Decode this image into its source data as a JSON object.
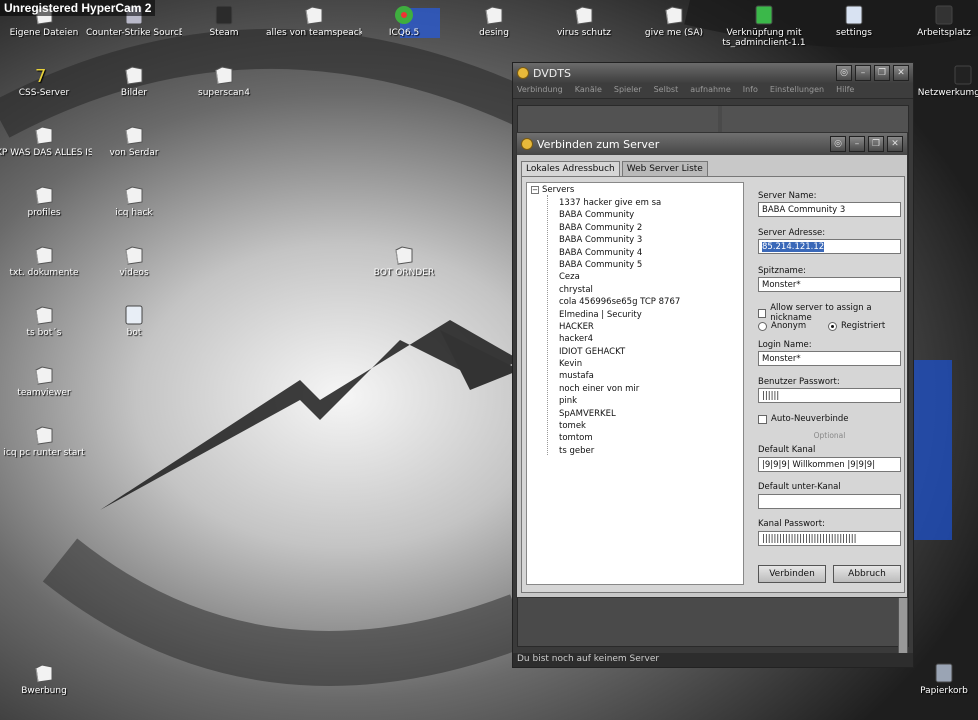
{
  "watermark": "Unregistered HyperCam 2",
  "desktop_icons": [
    {
      "label": "Eigene Dateien",
      "icon": "folder-icon"
    },
    {
      "label": "Counter-Strike SourcE",
      "icon": "cs-icon"
    },
    {
      "label": "Steam",
      "icon": "steam-icon"
    },
    {
      "label": "alles von teamspeack",
      "icon": "folder-icon"
    },
    {
      "label": "ICQ6.5",
      "icon": "icq-icon"
    },
    {
      "label": "desing",
      "icon": "folder-icon"
    },
    {
      "label": "virus schutz",
      "icon": "folder-icon"
    },
    {
      "label": "give me (SA)",
      "icon": "folder-icon"
    },
    {
      "label": "Verknüpfung mit ts_adminclient-1.1",
      "icon": "shortcut-icon"
    },
    {
      "label": "settings",
      "icon": "settings-icon"
    },
    {
      "label": "Arbeitsplatz",
      "icon": "computer-icon"
    },
    {
      "label": "CSS-Server",
      "icon": "server-icon"
    },
    {
      "label": "Bilder",
      "icon": "folder-icon"
    },
    {
      "label": "superscan4",
      "icon": "folder-icon"
    },
    {
      "label": "Netzwerkumgebung",
      "icon": "network-icon"
    },
    {
      "label": "KP WAS DAS ALLES IST",
      "icon": "folder-icon"
    },
    {
      "label": "von Serdar",
      "icon": "folder-icon"
    },
    {
      "label": "profiles",
      "icon": "folder-icon"
    },
    {
      "label": "icq hack",
      "icon": "folder-icon"
    },
    {
      "label": "txt. dokumente",
      "icon": "folder-icon"
    },
    {
      "label": "videos",
      "icon": "folder-icon"
    },
    {
      "label": "BOT ORNDER",
      "icon": "folder-icon"
    },
    {
      "label": "ts bot´s",
      "icon": "folder-icon"
    },
    {
      "label": "bot",
      "icon": "file-icon"
    },
    {
      "label": "teamviewer",
      "icon": "folder-icon"
    },
    {
      "label": "icq pc runter start",
      "icon": "folder-icon"
    },
    {
      "label": "Bwerbung",
      "icon": "folder-icon"
    },
    {
      "label": "Papierkorb",
      "icon": "recycle-bin-icon"
    }
  ],
  "main_window": {
    "title": "DVDTS",
    "menu": [
      "Verbindung",
      "Kanäle",
      "Spieler",
      "Selbst",
      "aufnahme",
      "Info",
      "Einstellungen",
      "Hilfe"
    ],
    "status": "Du bist noch auf keinem Server"
  },
  "dialog": {
    "title": "Verbinden zum Server",
    "tabs": [
      "Lokales Adressbuch",
      "Web Server Liste"
    ],
    "tree_root": "Servers",
    "servers": [
      "1337 hacker give em sa",
      "BABA Community",
      "BABA Community 2",
      "BABA Community 3",
      "BABA Community 4",
      "BABA Community 5",
      "Ceza",
      "chrystal",
      "cola  456996se65g   TCP 8767",
      "Elmedina | Security",
      "HACKER",
      "hacker4",
      "IDIOT GEHACKT",
      "Kevin",
      "mustafa",
      "noch einer von mir",
      "pink",
      "SpAMVERKEL",
      "tomek",
      "tomtom",
      "ts geber"
    ],
    "form": {
      "server_name_label": "Server Name:",
      "server_name": "BABA Community 3",
      "server_address_label": "Server Adresse:",
      "server_address": "85.214.121.12",
      "nickname_label": "Spitzname:",
      "nickname": "Monster*",
      "allow_nick_label": "Allow server to assign a nickname",
      "anon_label": "Anonym",
      "registered_label": "Registriert",
      "login_label": "Login Name:",
      "login": "Monster*",
      "password_label": "Benutzer Passwort:",
      "password": "||||||",
      "autoreconnect_label": "Auto-Neuverbinde",
      "optional_label": "Optional",
      "default_channel_label": "Default Kanal",
      "default_channel": "|9|9|9| Willkommen |9|9|9|",
      "default_subchannel_label": "Default unter-Kanal",
      "default_subchannel": "",
      "channel_password_label": "Kanal Passwort:",
      "channel_password": "|||||||||||||||||||||||||||||||||",
      "connect_button": "Verbinden",
      "cancel_button": "Abbruch"
    }
  }
}
